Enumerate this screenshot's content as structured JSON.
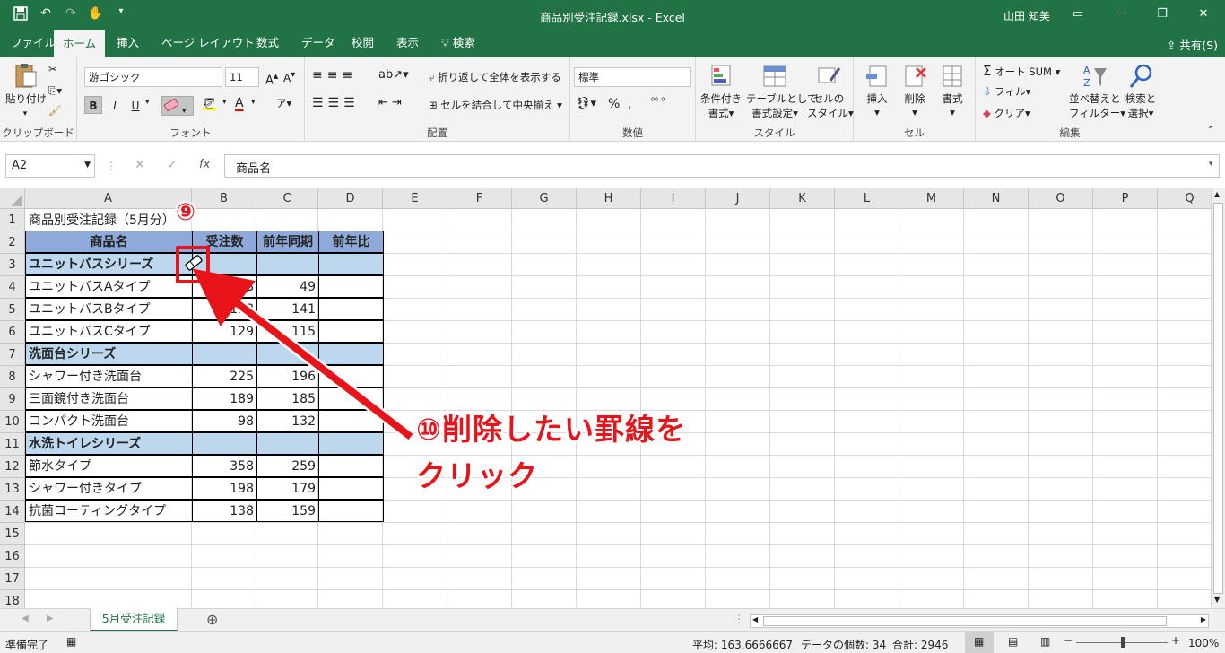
{
  "window": {
    "title": "商品別受注記録.xlsx  -  Excel",
    "user": "山田 知美",
    "minimize": "─",
    "restore": "❐",
    "close": "✕"
  },
  "tabs": [
    "ファイル",
    "ホーム",
    "挿入",
    "ページ レイアウト",
    "数式",
    "データ",
    "校閲",
    "表示",
    "検索"
  ],
  "share_label": "共有(S)",
  "ribbon": {
    "clipboard": {
      "paste": "貼り付け",
      "label": "クリップボード"
    },
    "font": {
      "name": "游ゴシック",
      "size": "11",
      "bold": "B",
      "italic": "I",
      "underline": "U",
      "label": "フォント"
    },
    "alignment": {
      "wrap": "折り返して全体を表示する",
      "merge": "セルを結合して中央揃え",
      "label": "配置"
    },
    "number": {
      "format": "標準",
      "label": "数値"
    },
    "styles": {
      "conditional": [
        "条件付き",
        "書式"
      ],
      "table": [
        "テーブルとして",
        "書式設定"
      ],
      "cell": [
        "セルの",
        "スタイル"
      ],
      "label": "スタイル"
    },
    "cells": {
      "insert": "挿入",
      "delete": "削除",
      "format": "書式",
      "label": "セル"
    },
    "editing": {
      "autosum": "オート SUM",
      "fill": "フィル",
      "clear": "クリア",
      "sort": [
        "並べ替えと",
        "フィルター"
      ],
      "find": [
        "検索と",
        "選択"
      ],
      "label": "編集"
    }
  },
  "formula_bar": {
    "name_box": "A2",
    "fx": "fx",
    "content": "商品名"
  },
  "columns": [
    "A",
    "B",
    "C",
    "D",
    "E",
    "F",
    "G",
    "H",
    "I",
    "J",
    "K",
    "L",
    "M",
    "N",
    "O",
    "P",
    "Q"
  ],
  "rows": [
    "1",
    "2",
    "3",
    "4",
    "5",
    "6",
    "7",
    "8",
    "9",
    "10",
    "11",
    "12",
    "13",
    "14",
    "15",
    "16",
    "17",
    "18"
  ],
  "sheet": {
    "title": "商品別受注記録（5月分）",
    "headers": [
      "商品名",
      "受注数",
      "前年同期",
      "前年比"
    ],
    "table": [
      {
        "kind": "cat",
        "name": "ユニットバスシリーズ"
      },
      {
        "kind": "data",
        "name": "ユニットバスAタイプ",
        "orders": "58",
        "prev": "49"
      },
      {
        "kind": "data",
        "name": "ユニットバスBタイプ",
        "orders": "128",
        "prev": "141"
      },
      {
        "kind": "data",
        "name": "ユニットバスCタイプ",
        "orders": "129",
        "prev": "115"
      },
      {
        "kind": "cat",
        "name": "洗面台シリーズ"
      },
      {
        "kind": "data",
        "name": "シャワー付き洗面台",
        "orders": "225",
        "prev": "196"
      },
      {
        "kind": "data",
        "name": "三面鏡付き洗面台",
        "orders": "189",
        "prev": "185"
      },
      {
        "kind": "data",
        "name": "コンパクト洗面台",
        "orders": "98",
        "prev": "132"
      },
      {
        "kind": "cat",
        "name": "水洗トイレシリーズ"
      },
      {
        "kind": "data",
        "name": "節水タイプ",
        "orders": "358",
        "prev": "259"
      },
      {
        "kind": "data",
        "name": "シャワー付きタイプ",
        "orders": "198",
        "prev": "179"
      },
      {
        "kind": "data",
        "name": "抗菌コーティングタイプ",
        "orders": "138",
        "prev": "159"
      }
    ]
  },
  "sheet_tab": "5月受注記録",
  "status": {
    "ready": "準備完了",
    "average": "平均: 163.6666667",
    "count": "データの個数: 34",
    "sum": "合計: 2946",
    "zoom": "100%"
  },
  "annotations": {
    "step9": "⑨",
    "step10_line1": "⑩削除したい罫線を",
    "step10_line2": "クリック"
  },
  "colors": {
    "accent": "#217346",
    "header_fill": "#8eaadb",
    "category_fill": "#bdd7ee",
    "annotation": "#e8141a"
  }
}
